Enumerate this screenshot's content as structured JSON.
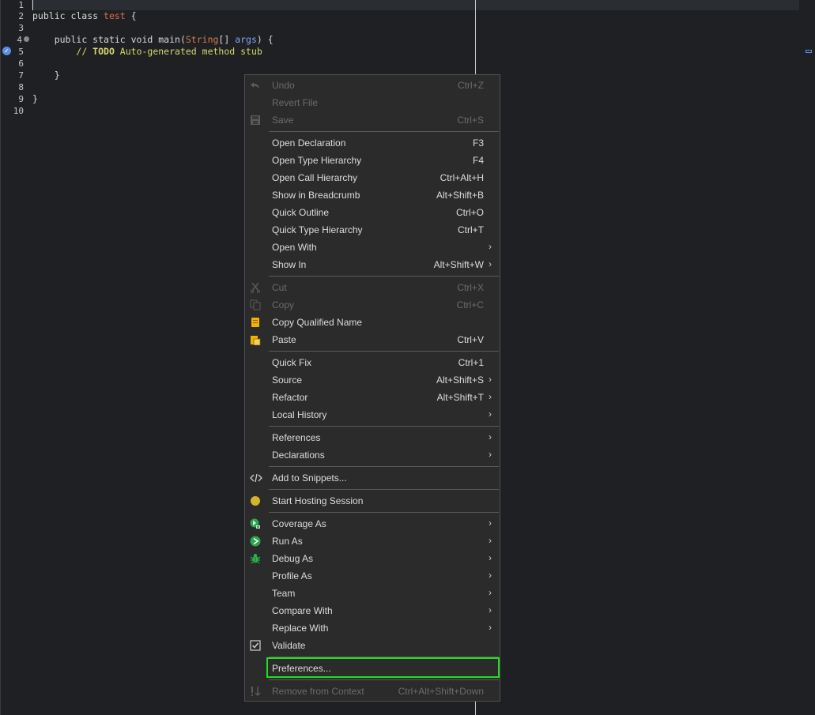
{
  "editor": {
    "line_numbers": [
      "1",
      "2",
      "3",
      "4",
      "5",
      "6",
      "7",
      "8",
      "9",
      "10"
    ],
    "line2": {
      "kw": "public class ",
      "cls": "test",
      "rest": " {"
    },
    "line4": {
      "indent": "    ",
      "kw": "public static void main(",
      "type": "String",
      "mid": "[] ",
      "arg": "args",
      "rest": ") {"
    },
    "line5": {
      "indent": "        ",
      "cmt1": "// ",
      "todo": "TODO",
      "cmt2": " Auto-generated method stub"
    },
    "line7": "    }",
    "line9": "}"
  },
  "menu": {
    "items": [
      {
        "label": "Undo",
        "acc": "Ctrl+Z",
        "disabled": true,
        "icon": "undo-icon"
      },
      {
        "label": "Revert File",
        "acc": "",
        "disabled": true,
        "icon": ""
      },
      {
        "label": "Save",
        "acc": "Ctrl+S",
        "disabled": true,
        "icon": "save-icon"
      },
      {
        "label": "Open Declaration",
        "acc": "F3"
      },
      {
        "label": "Open Type Hierarchy",
        "acc": "F4"
      },
      {
        "label": "Open Call Hierarchy",
        "acc": "Ctrl+Alt+H"
      },
      {
        "label": "Show in Breadcrumb",
        "acc": "Alt+Shift+B"
      },
      {
        "label": "Quick Outline",
        "acc": "Ctrl+O"
      },
      {
        "label": "Quick Type Hierarchy",
        "acc": "Ctrl+T"
      },
      {
        "label": "Open With",
        "acc": "",
        "submenu": true
      },
      {
        "label": "Show In",
        "acc": "Alt+Shift+W",
        "submenu": true
      },
      {
        "label": "Cut",
        "acc": "Ctrl+X",
        "disabled": true,
        "icon": "cut-icon"
      },
      {
        "label": "Copy",
        "acc": "Ctrl+C",
        "disabled": true,
        "icon": "copy-icon"
      },
      {
        "label": "Copy Qualified Name",
        "acc": "",
        "icon": "copy-qualified-name-icon"
      },
      {
        "label": "Paste",
        "acc": "Ctrl+V",
        "icon": "paste-icon"
      },
      {
        "label": "Quick Fix",
        "acc": "Ctrl+1"
      },
      {
        "label": "Source",
        "acc": "Alt+Shift+S",
        "submenu": true
      },
      {
        "label": "Refactor",
        "acc": "Alt+Shift+T",
        "submenu": true
      },
      {
        "label": "Local History",
        "acc": "",
        "submenu": true
      },
      {
        "label": "References",
        "acc": "",
        "submenu": true
      },
      {
        "label": "Declarations",
        "acc": "",
        "submenu": true
      },
      {
        "label": "Add to Snippets...",
        "acc": "",
        "icon": "snippet-icon"
      },
      {
        "label": "Start Hosting Session",
        "acc": "",
        "icon": "hosting-icon"
      },
      {
        "label": "Coverage As",
        "acc": "",
        "submenu": true,
        "icon": "coverage-icon"
      },
      {
        "label": "Run As",
        "acc": "",
        "submenu": true,
        "icon": "run-icon"
      },
      {
        "label": "Debug As",
        "acc": "",
        "submenu": true,
        "icon": "debug-icon"
      },
      {
        "label": "Profile As",
        "acc": "",
        "submenu": true
      },
      {
        "label": "Team",
        "acc": "",
        "submenu": true
      },
      {
        "label": "Compare With",
        "acc": "",
        "submenu": true
      },
      {
        "label": "Replace With",
        "acc": "",
        "submenu": true
      },
      {
        "label": "Validate",
        "acc": "",
        "icon": "validate-icon"
      },
      {
        "label": "Preferences...",
        "acc": ""
      },
      {
        "label": "Remove from Context",
        "acc": "Ctrl+Alt+Shift+Down",
        "disabled": true,
        "icon": "remove-context-icon"
      }
    ],
    "submenu_arrow": "›",
    "colors": {
      "highlight": "#22dd22",
      "background": "#2b2b2b",
      "text": "#dddddd",
      "disabled": "#6b6b6b"
    }
  }
}
